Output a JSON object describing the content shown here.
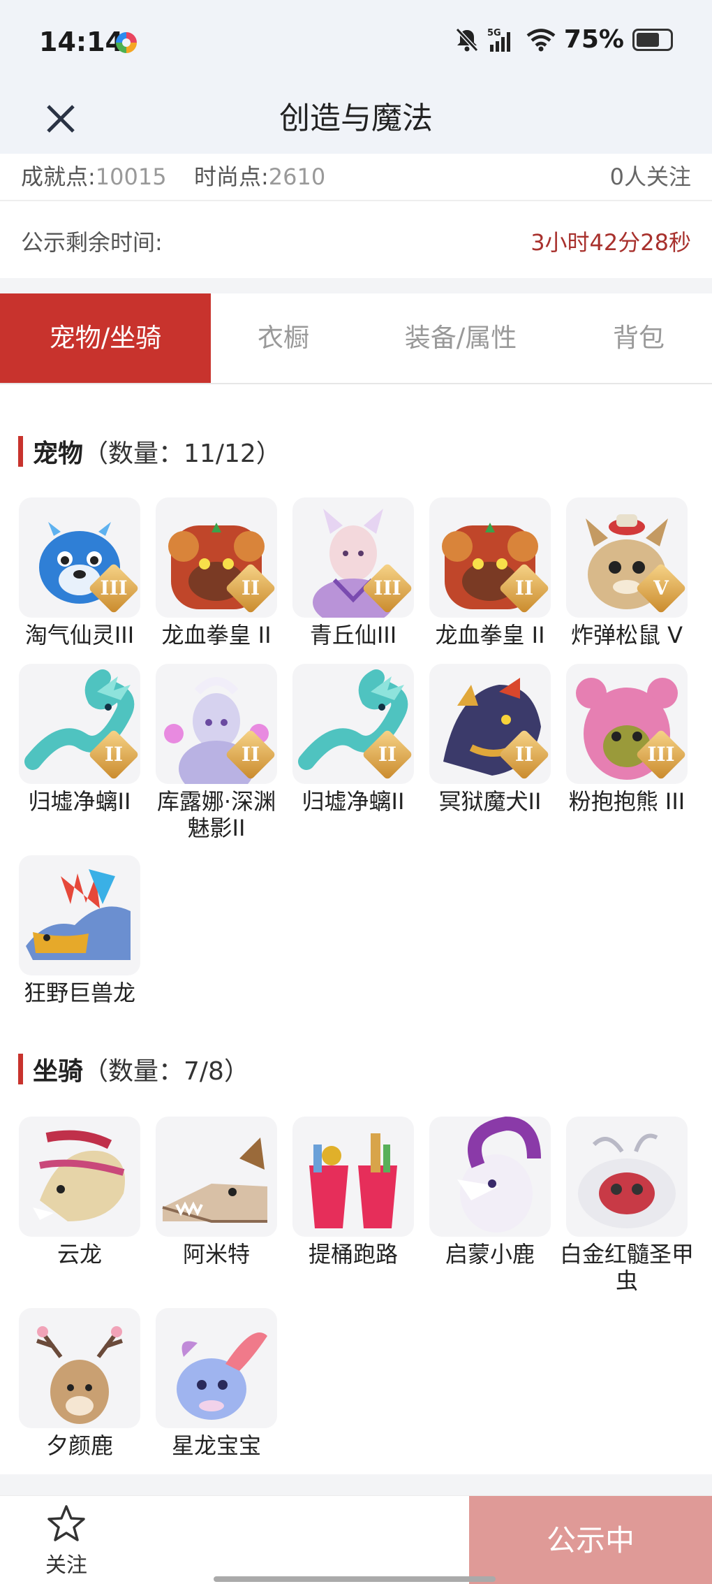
{
  "status_bar": {
    "time": "14:14",
    "network": "5G",
    "battery": "75%"
  },
  "nav": {
    "title": "创造与魔法"
  },
  "stats": {
    "achievement_label": "成就点:",
    "achievement_value": "10015",
    "fashion_label": "时尚点:",
    "fashion_value": "2610",
    "followers": "0人关注"
  },
  "timer": {
    "label": "公示剩余时间:",
    "value": "3小时42分28秒"
  },
  "tabs": [
    {
      "label": "宠物/坐骑",
      "active": true
    },
    {
      "label": "衣橱",
      "active": false
    },
    {
      "label": "装备/属性",
      "active": false
    },
    {
      "label": "背包",
      "active": false
    }
  ],
  "pets": {
    "title": "宠物",
    "count": "（数量：11/12）",
    "items": [
      {
        "name": "淘气仙灵III",
        "badge": "III",
        "icon": "blue-fairy-pet"
      },
      {
        "name": "龙血拳皇 II",
        "badge": "II",
        "icon": "dragon-boxer-pet"
      },
      {
        "name": "青丘仙III",
        "badge": "III",
        "icon": "fox-fairy-pet"
      },
      {
        "name": "龙血拳皇 II",
        "badge": "II",
        "icon": "dragon-boxer-pet"
      },
      {
        "name": "炸弹松鼠 V",
        "badge": "V",
        "icon": "bomb-squirrel-pet"
      },
      {
        "name": "归墟净螭II",
        "badge": "II",
        "icon": "jade-dragon-pet"
      },
      {
        "name": "库露娜·深渊魅影II",
        "badge": "II",
        "icon": "abyss-phantom-pet"
      },
      {
        "name": "归墟净螭II",
        "badge": "II",
        "icon": "jade-dragon-pet"
      },
      {
        "name": "冥狱魔犬II",
        "badge": "II",
        "icon": "hell-hound-pet"
      },
      {
        "name": "粉抱抱熊 III",
        "badge": "III",
        "icon": "pink-bear-pet"
      },
      {
        "name": "狂野巨兽龙",
        "badge": "",
        "icon": "wild-dino-pet"
      }
    ]
  },
  "mounts": {
    "title": "坐骑",
    "count": "（数量：7/8）",
    "items": [
      {
        "name": "云龙",
        "icon": "cloud-dragon-mount"
      },
      {
        "name": "阿米特",
        "icon": "ammit-crocodile-mount"
      },
      {
        "name": "提桶跑路",
        "icon": "bucket-mount"
      },
      {
        "name": "启蒙小鹿",
        "icon": "purple-fawn-mount"
      },
      {
        "name": "白金红髓圣甲虫",
        "icon": "scarab-mount"
      },
      {
        "name": "夕颜鹿",
        "icon": "sakura-deer-mount"
      },
      {
        "name": "星龙宝宝",
        "icon": "star-dragon-baby-mount"
      }
    ]
  },
  "bottom": {
    "follow_label": "关注",
    "cta_label": "公示中"
  },
  "colors": {
    "accent": "#c8332d",
    "timer": "#a8312d",
    "cta": "#df9a97",
    "header_bg": "#f0f3f8"
  }
}
